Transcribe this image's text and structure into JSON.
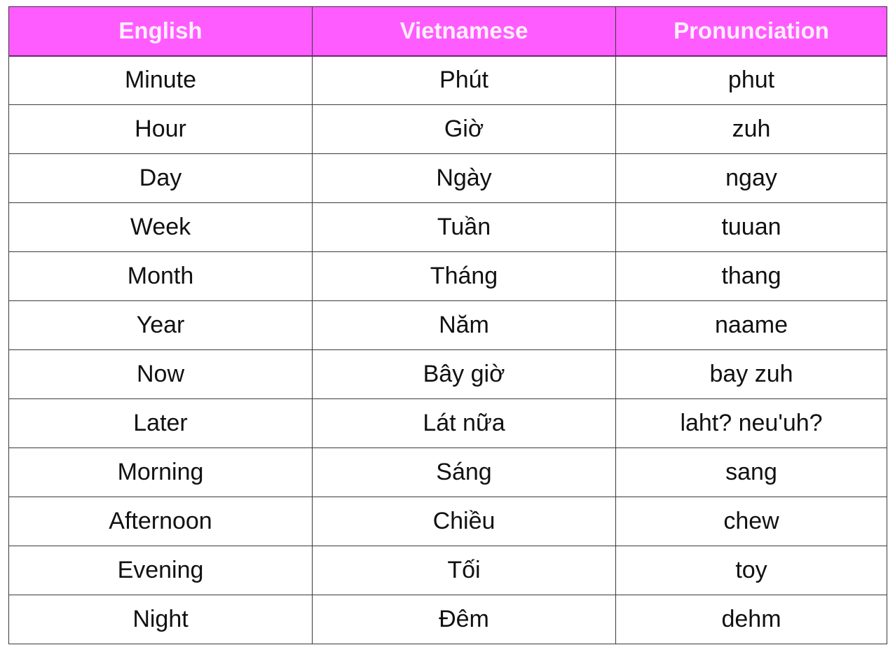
{
  "table": {
    "header_color": "#ff5cff",
    "columns": [
      "English",
      "Vietnamese",
      "Pronunciation"
    ],
    "rows": [
      {
        "english": "Minute",
        "vietnamese": "Phút",
        "pronunciation": "phut"
      },
      {
        "english": "Hour",
        "vietnamese": "Giờ",
        "pronunciation": "zuh"
      },
      {
        "english": "Day",
        "vietnamese": "Ngày",
        "pronunciation": "ngay"
      },
      {
        "english": "Week",
        "vietnamese": "Tuần",
        "pronunciation": "tuuan"
      },
      {
        "english": "Month",
        "vietnamese": "Tháng",
        "pronunciation": "thang"
      },
      {
        "english": "Year",
        "vietnamese": "Năm",
        "pronunciation": "naame"
      },
      {
        "english": "Now",
        "vietnamese": "Bây giờ",
        "pronunciation": "bay zuh"
      },
      {
        "english": "Later",
        "vietnamese": "Lát nữa",
        "pronunciation": "laht? neu'uh?"
      },
      {
        "english": "Morning",
        "vietnamese": "Sáng",
        "pronunciation": "sang"
      },
      {
        "english": "Afternoon",
        "vietnamese": "Chiều",
        "pronunciation": "chew"
      },
      {
        "english": "Evening",
        "vietnamese": "Tối",
        "pronunciation": "toy"
      },
      {
        "english": "Night",
        "vietnamese": "Đêm",
        "pronunciation": "dehm"
      }
    ]
  }
}
